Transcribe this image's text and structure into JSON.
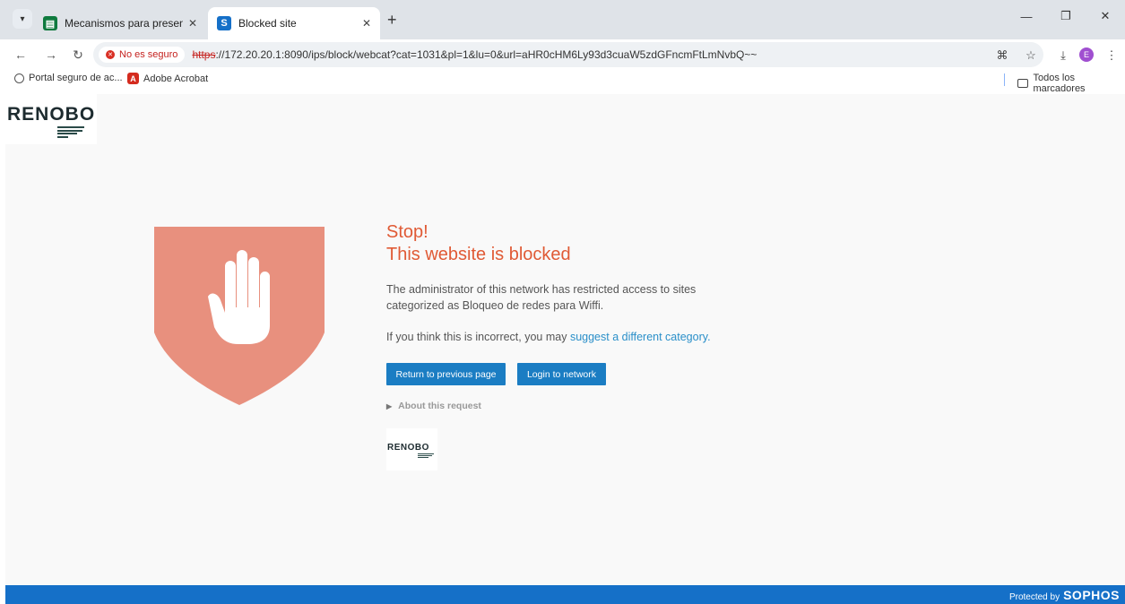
{
  "browser": {
    "tabs": [
      {
        "title": "Mecanismos para presentar Pet",
        "favicon": "sheets-icon",
        "close": "✕"
      },
      {
        "title": "Blocked site",
        "favicon": "sophos-icon",
        "close": "✕"
      }
    ],
    "new_tab": "+",
    "window_controls": {
      "minimize": "—",
      "restore": "❐",
      "close": "✕"
    },
    "security_label": "No es seguro",
    "url_scheme": "https",
    "url_rest": "://172.20.20.1:8090/ips/block/webcat?cat=1031&pl=1&lu=0&url=aHR0cHM6Ly93d3cuaW5zdGFncmFtLmNvbQ~~",
    "profile_initial": "E"
  },
  "bookmarks": {
    "items": [
      {
        "label": "Portal seguro de ac...",
        "icon": "globe-icon"
      },
      {
        "label": "Adobe Acrobat",
        "icon": "acrobat-icon"
      }
    ],
    "all_bookmarks": "Todos los marcadores"
  },
  "page": {
    "logo_text": "RENOBO",
    "title": "Stop!",
    "subtitle": "This website is blocked",
    "message": "The administrator of this network has restricted access to sites categorized as Bloqueo de redes para Wiffi.",
    "incorrect_prefix": "If you think this is incorrect, you may ",
    "suggest_link": "suggest a different category",
    "incorrect_suffix": ".",
    "return_button": "Return to previous page",
    "login_button": "Login to network",
    "about": "About this request",
    "logo_small_text": "RENOBO",
    "accent_color": "#e05a35",
    "shield_color": "#e8907e"
  },
  "footer": {
    "protected_by": "Protected by",
    "brand": "SOPHOS"
  }
}
